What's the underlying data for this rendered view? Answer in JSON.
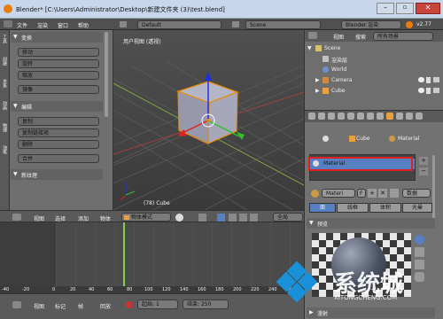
{
  "titlebar": {
    "title": "Blender* [C:\\Users\\Administrator\\Desktop\\新建文件夹 (3)\\test.blend]"
  },
  "menubar": {
    "items": [
      "文件",
      "渲染",
      "窗口",
      "帮助"
    ],
    "screen": "Default",
    "scene": "Scene",
    "engine": "Blender 渲染",
    "version": "v2.77"
  },
  "toolshelf": {
    "tabs": [
      "工具",
      "创建",
      "关系",
      "动画",
      "物理",
      "油笔"
    ],
    "transform_header": "变换",
    "transform_buttons": [
      "移动",
      "旋转",
      "缩放",
      "镜像"
    ],
    "edit_header": "编辑",
    "edit_buttons": [
      "复制",
      "复制链接项",
      "删除",
      "合并"
    ],
    "history_header": "新纹理"
  },
  "viewport": {
    "view_label": "用户视图 (透视)",
    "object_label": "(78) Cube"
  },
  "outliner": {
    "menu": [
      "视图",
      "搜索"
    ],
    "filter": "所有场景",
    "items": [
      "Scene",
      "渲染层",
      "World",
      "Camera",
      "Cube"
    ]
  },
  "properties": {
    "breadcrumb": [
      "Cube",
      "Material"
    ],
    "material_slot": "Material",
    "material_name": "Materi",
    "users": "F",
    "data_label": "数据",
    "tabs": [
      "面",
      "线框",
      "体积",
      "光晕"
    ],
    "preview_header": "预览",
    "diffuse_header": "漫射"
  },
  "timeline": {
    "menu": [
      "视图",
      "选择",
      "添加",
      "物体"
    ],
    "mode": "物体模式",
    "pivot": "全局",
    "ruler": [
      "-40",
      "-20",
      "0",
      "20",
      "40",
      "60",
      "80",
      "100",
      "120",
      "140",
      "160",
      "180",
      "200",
      "220",
      "240",
      "260"
    ],
    "footer_menu": [
      "视图",
      "标记",
      "帧",
      "回放"
    ],
    "start_label": "起始:",
    "start_val": "1",
    "end_label": "结束:",
    "end_val": "250"
  },
  "watermark": {
    "text": "系统城",
    "url": "XITONGCHENG.COM"
  },
  "colors": {
    "accent": "#e88a00",
    "selected": "#5680c2",
    "highlight_box": "#e02020"
  }
}
